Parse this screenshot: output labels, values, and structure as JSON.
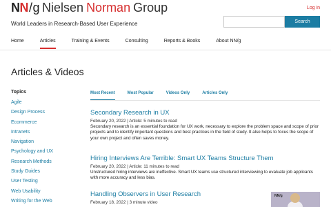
{
  "brand": {
    "mark_n1": "N",
    "mark_n2": "N",
    "mark_slash": "/",
    "mark_g": "g",
    "name_1": "Nielsen",
    "name_2": "Norman",
    "name_3": "Group",
    "tagline": "World Leaders in Research-Based User Experience",
    "accent_color": "#d62e2e",
    "link_color": "#1c7da3"
  },
  "header": {
    "login_label": "Log in",
    "search_placeholder": "",
    "search_button": "Search"
  },
  "nav": {
    "items": [
      {
        "label": "Home"
      },
      {
        "label": "Articles"
      },
      {
        "label": "Training & Events"
      },
      {
        "label": "Consulting"
      },
      {
        "label": "Reports & Books"
      },
      {
        "label": "About NN/g"
      }
    ],
    "active": "Articles"
  },
  "page": {
    "title": "Articles & Videos"
  },
  "sidebar": {
    "heading": "Topics",
    "items": [
      {
        "label": "Agile"
      },
      {
        "label": "Design Process"
      },
      {
        "label": "Ecommerce"
      },
      {
        "label": "Intranets"
      },
      {
        "label": "Navigation"
      },
      {
        "label": "Psychology and UX"
      },
      {
        "label": "Research Methods"
      },
      {
        "label": "Study Guides"
      },
      {
        "label": "User Testing"
      },
      {
        "label": "Web Usability"
      },
      {
        "label": "Writing for the Web"
      }
    ]
  },
  "tabs": {
    "items": [
      {
        "label": "Most Recent"
      },
      {
        "label": "Most Popular"
      },
      {
        "label": "Videos Only"
      },
      {
        "label": "Articles Only"
      }
    ],
    "active": "Most Recent"
  },
  "articles": [
    {
      "title": "Secondary Research in UX",
      "meta": "February 20, 2022 | Article: 5 minutes to read",
      "desc": "Secondary research is an essential foundation for UX work, necessary to explore the problem space and scope of prior projects and to identify important questions and best practices in the field of study. It also helps to focus the scope of your own project and often saves money."
    },
    {
      "title": "Hiring Interviews Are Terrible: Smart UX Teams Structure Them",
      "meta": "February 20, 2022 | Article: 11 minutes to read",
      "desc": "Unstructured hiring interviews are ineffective. Smart UX teams use structured interviewing to evaluate job applicants with more accuracy and less bias."
    },
    {
      "title": "Handling Observers in User Research",
      "meta": "February 18, 2022 | 3 minute video",
      "desc": ""
    }
  ],
  "video_thumb": {
    "logo_text": "NN/g",
    "icon": "video-thumbnail"
  }
}
